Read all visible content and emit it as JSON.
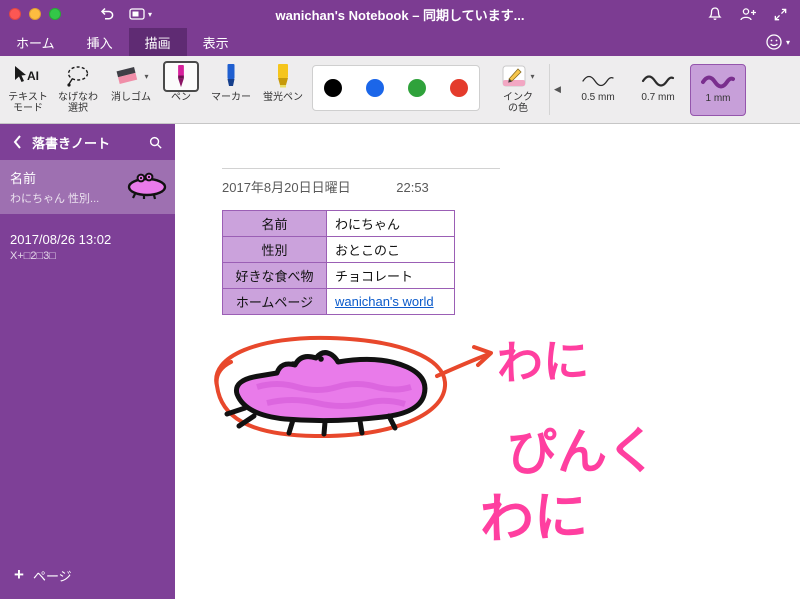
{
  "titlebar": {
    "title": "wanichan's Notebook – 同期しています..."
  },
  "tabs": {
    "items": [
      {
        "label": "ホーム",
        "active": false
      },
      {
        "label": "挿入",
        "active": false
      },
      {
        "label": "描画",
        "active": true
      },
      {
        "label": "表示",
        "active": false
      }
    ]
  },
  "ribbon": {
    "text_mode": {
      "line1": "テキスト",
      "line2": "モード"
    },
    "lasso": {
      "line1": "なげなわ",
      "line2": "選択"
    },
    "eraser_label": "消しゴム",
    "pen_label": "ペン",
    "marker_label": "マーカー",
    "highlighter_label": "蛍光ペン",
    "ink_color": {
      "line1": "インク",
      "line2": "の色"
    },
    "palette": [
      "#000000",
      "#1B66E9",
      "#2FA23B",
      "#E43B2C"
    ],
    "thickness": [
      {
        "label": "0.5 mm",
        "selected": false
      },
      {
        "label": "0.7 mm",
        "selected": false
      },
      {
        "label": "1 mm",
        "selected": true
      }
    ]
  },
  "sidebar": {
    "notebook_title": "落書きノート",
    "pages": [
      {
        "title": "名前",
        "subtitle": "わにちゃん 性別...",
        "selected": true
      },
      {
        "title": "2017/08/26 13:02",
        "subtitle": "X+□2□3□",
        "selected": false
      }
    ],
    "add_page_label": "ページ"
  },
  "canvas": {
    "date": "2017年8月20日日曜日",
    "time": "22:53",
    "table": {
      "rows": [
        {
          "label": "名前",
          "value": "わにちゃん"
        },
        {
          "label": "性別",
          "value": "おとこのこ"
        },
        {
          "label": "好きな食べ物",
          "value": "チョコレート"
        },
        {
          "label": "ホームページ",
          "value": "wanichan's world"
        }
      ]
    },
    "handwriting": [
      "わに",
      "ぴんく",
      "わに"
    ]
  },
  "icons": {
    "dropdown_caret": "▾",
    "size_prev": "◀",
    "add": "+",
    "text_mode_glyph": "AI"
  },
  "colors": {
    "titlebar_purple": "#7C3C92",
    "active_tab_purple": "#5F2B73",
    "sidebar_purple": "#7E4097",
    "thickness_selected": "#C79FD9",
    "table_header": "#CBA2DC",
    "table_border": "#9B5FB5",
    "link_blue": "#0B5BCB",
    "ink_pink": "#FF3FA0",
    "ink_red": "#E8482C",
    "croc_pink": "#E97BEA"
  }
}
